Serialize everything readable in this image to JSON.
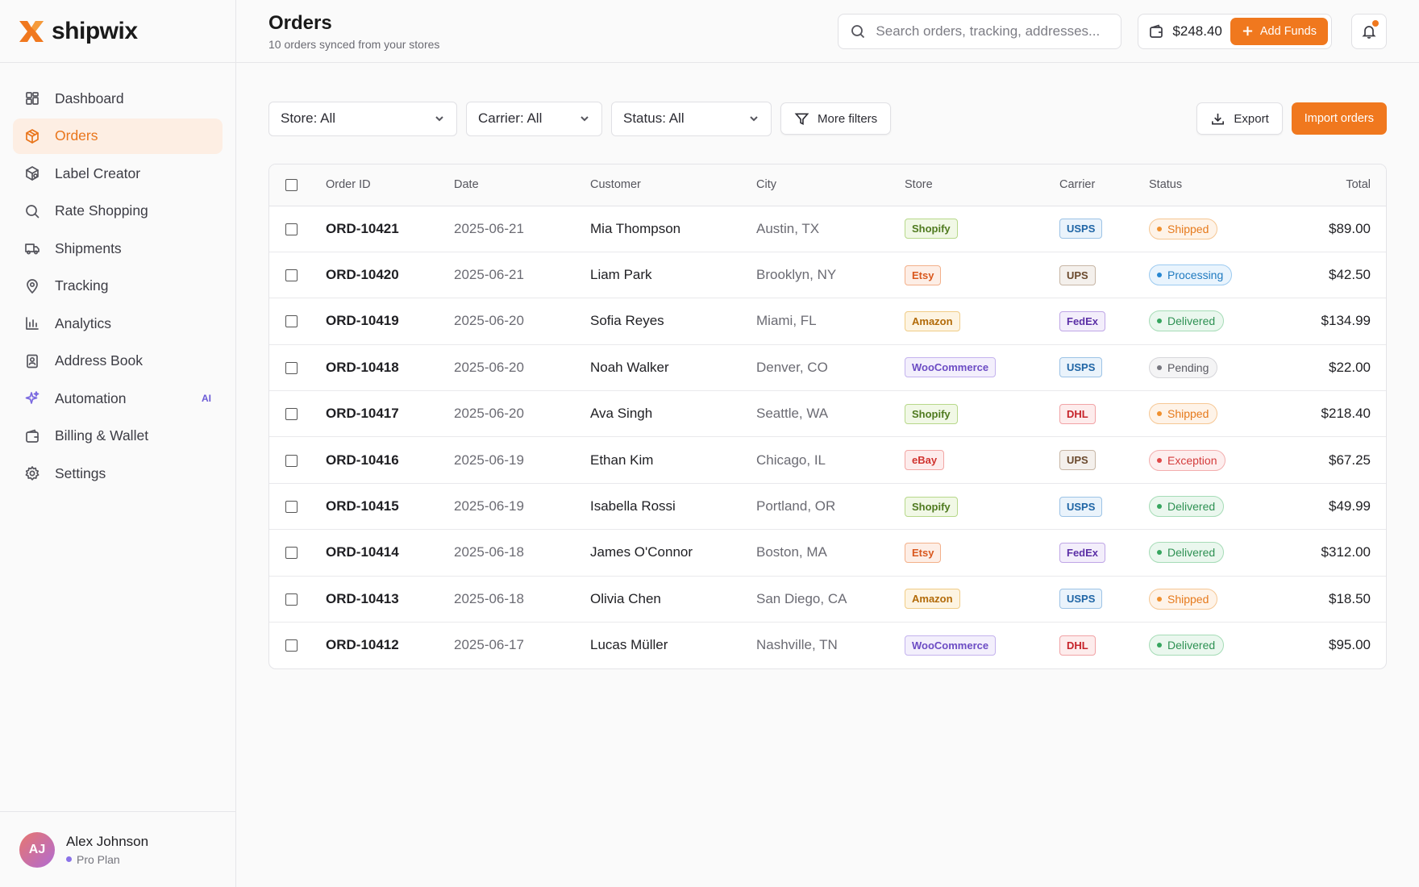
{
  "brand": {
    "name": "shipwix"
  },
  "sidebar": {
    "items": [
      {
        "label": "Dashboard",
        "icon": "dashboard-icon"
      },
      {
        "label": "Orders",
        "icon": "box-icon",
        "active": true
      },
      {
        "label": "Label Creator",
        "icon": "package-icon"
      },
      {
        "label": "Rate Shopping",
        "icon": "search-icon"
      },
      {
        "label": "Shipments",
        "icon": "truck-icon"
      },
      {
        "label": "Tracking",
        "icon": "map-pin-icon"
      },
      {
        "label": "Analytics",
        "icon": "bar-chart-icon"
      },
      {
        "label": "Address Book",
        "icon": "address-book-icon"
      },
      {
        "label": "Automation",
        "icon": "sparkles-icon",
        "badge": "AI"
      },
      {
        "label": "Billing & Wallet",
        "icon": "wallet-icon"
      },
      {
        "label": "Settings",
        "icon": "gear-icon"
      }
    ]
  },
  "profile": {
    "initials": "AJ",
    "name": "Alex Johnson",
    "plan": "Pro Plan"
  },
  "header": {
    "title": "Orders",
    "subtitle": "10 orders synced from your stores",
    "search_placeholder": "Search orders, tracking, addresses...",
    "wallet_balance": "$248.40",
    "add_funds_label": "Add Funds"
  },
  "filters": {
    "store": "Store: All",
    "carrier": "Carrier: All",
    "status": "Status: All",
    "more_filters": "More filters",
    "export": "Export",
    "import": "Import orders"
  },
  "table": {
    "columns": [
      "Order ID",
      "Date",
      "Customer",
      "City",
      "Store",
      "Carrier",
      "Status",
      "Total"
    ],
    "rows": [
      {
        "id": "ORD-10421",
        "date": "2025-06-21",
        "customer": "Mia Thompson",
        "city": "Austin, TX",
        "store": "Shopify",
        "carrier": "USPS",
        "status": "Shipped",
        "total": "$89.00"
      },
      {
        "id": "ORD-10420",
        "date": "2025-06-21",
        "customer": "Liam Park",
        "city": "Brooklyn, NY",
        "store": "Etsy",
        "carrier": "UPS",
        "status": "Processing",
        "total": "$42.50"
      },
      {
        "id": "ORD-10419",
        "date": "2025-06-20",
        "customer": "Sofia Reyes",
        "city": "Miami, FL",
        "store": "Amazon",
        "carrier": "FedEx",
        "status": "Delivered",
        "total": "$134.99"
      },
      {
        "id": "ORD-10418",
        "date": "2025-06-20",
        "customer": "Noah Walker",
        "city": "Denver, CO",
        "store": "WooCommerce",
        "carrier": "USPS",
        "status": "Pending",
        "total": "$22.00"
      },
      {
        "id": "ORD-10417",
        "date": "2025-06-20",
        "customer": "Ava Singh",
        "city": "Seattle, WA",
        "store": "Shopify",
        "carrier": "DHL",
        "status": "Shipped",
        "total": "$218.40"
      },
      {
        "id": "ORD-10416",
        "date": "2025-06-19",
        "customer": "Ethan Kim",
        "city": "Chicago, IL",
        "store": "eBay",
        "carrier": "UPS",
        "status": "Exception",
        "total": "$67.25"
      },
      {
        "id": "ORD-10415",
        "date": "2025-06-19",
        "customer": "Isabella Rossi",
        "city": "Portland, OR",
        "store": "Shopify",
        "carrier": "USPS",
        "status": "Delivered",
        "total": "$49.99"
      },
      {
        "id": "ORD-10414",
        "date": "2025-06-18",
        "customer": "James O'Connor",
        "city": "Boston, MA",
        "store": "Etsy",
        "carrier": "FedEx",
        "status": "Delivered",
        "total": "$312.00"
      },
      {
        "id": "ORD-10413",
        "date": "2025-06-18",
        "customer": "Olivia Chen",
        "city": "San Diego, CA",
        "store": "Amazon",
        "carrier": "USPS",
        "status": "Shipped",
        "total": "$18.50"
      },
      {
        "id": "ORD-10412",
        "date": "2025-06-17",
        "customer": "Lucas Müller",
        "city": "Nashville, TN",
        "store": "WooCommerce",
        "carrier": "DHL",
        "status": "Delivered",
        "total": "$95.00"
      }
    ]
  },
  "colors": {
    "accent": "#f0781e",
    "active_bg": "#fdeee3"
  }
}
